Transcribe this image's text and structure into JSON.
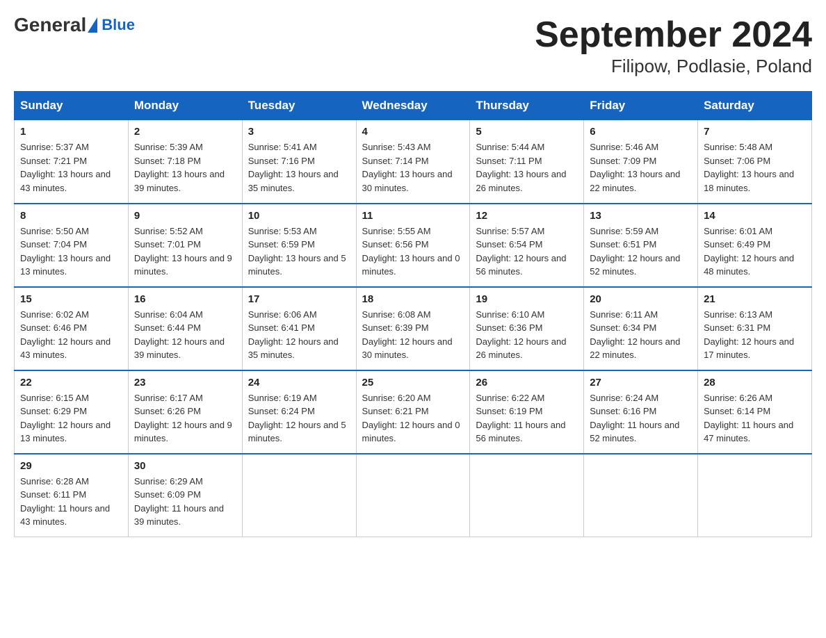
{
  "header": {
    "logo_general": "General",
    "logo_blue": "Blue",
    "month_year": "September 2024",
    "location": "Filipow, Podlasie, Poland"
  },
  "weekdays": [
    "Sunday",
    "Monday",
    "Tuesday",
    "Wednesday",
    "Thursday",
    "Friday",
    "Saturday"
  ],
  "weeks": [
    [
      {
        "day": "1",
        "sunrise": "5:37 AM",
        "sunset": "7:21 PM",
        "daylight": "13 hours and 43 minutes."
      },
      {
        "day": "2",
        "sunrise": "5:39 AM",
        "sunset": "7:18 PM",
        "daylight": "13 hours and 39 minutes."
      },
      {
        "day": "3",
        "sunrise": "5:41 AM",
        "sunset": "7:16 PM",
        "daylight": "13 hours and 35 minutes."
      },
      {
        "day": "4",
        "sunrise": "5:43 AM",
        "sunset": "7:14 PM",
        "daylight": "13 hours and 30 minutes."
      },
      {
        "day": "5",
        "sunrise": "5:44 AM",
        "sunset": "7:11 PM",
        "daylight": "13 hours and 26 minutes."
      },
      {
        "day": "6",
        "sunrise": "5:46 AM",
        "sunset": "7:09 PM",
        "daylight": "13 hours and 22 minutes."
      },
      {
        "day": "7",
        "sunrise": "5:48 AM",
        "sunset": "7:06 PM",
        "daylight": "13 hours and 18 minutes."
      }
    ],
    [
      {
        "day": "8",
        "sunrise": "5:50 AM",
        "sunset": "7:04 PM",
        "daylight": "13 hours and 13 minutes."
      },
      {
        "day": "9",
        "sunrise": "5:52 AM",
        "sunset": "7:01 PM",
        "daylight": "13 hours and 9 minutes."
      },
      {
        "day": "10",
        "sunrise": "5:53 AM",
        "sunset": "6:59 PM",
        "daylight": "13 hours and 5 minutes."
      },
      {
        "day": "11",
        "sunrise": "5:55 AM",
        "sunset": "6:56 PM",
        "daylight": "13 hours and 0 minutes."
      },
      {
        "day": "12",
        "sunrise": "5:57 AM",
        "sunset": "6:54 PM",
        "daylight": "12 hours and 56 minutes."
      },
      {
        "day": "13",
        "sunrise": "5:59 AM",
        "sunset": "6:51 PM",
        "daylight": "12 hours and 52 minutes."
      },
      {
        "day": "14",
        "sunrise": "6:01 AM",
        "sunset": "6:49 PM",
        "daylight": "12 hours and 48 minutes."
      }
    ],
    [
      {
        "day": "15",
        "sunrise": "6:02 AM",
        "sunset": "6:46 PM",
        "daylight": "12 hours and 43 minutes."
      },
      {
        "day": "16",
        "sunrise": "6:04 AM",
        "sunset": "6:44 PM",
        "daylight": "12 hours and 39 minutes."
      },
      {
        "day": "17",
        "sunrise": "6:06 AM",
        "sunset": "6:41 PM",
        "daylight": "12 hours and 35 minutes."
      },
      {
        "day": "18",
        "sunrise": "6:08 AM",
        "sunset": "6:39 PM",
        "daylight": "12 hours and 30 minutes."
      },
      {
        "day": "19",
        "sunrise": "6:10 AM",
        "sunset": "6:36 PM",
        "daylight": "12 hours and 26 minutes."
      },
      {
        "day": "20",
        "sunrise": "6:11 AM",
        "sunset": "6:34 PM",
        "daylight": "12 hours and 22 minutes."
      },
      {
        "day": "21",
        "sunrise": "6:13 AM",
        "sunset": "6:31 PM",
        "daylight": "12 hours and 17 minutes."
      }
    ],
    [
      {
        "day": "22",
        "sunrise": "6:15 AM",
        "sunset": "6:29 PM",
        "daylight": "12 hours and 13 minutes."
      },
      {
        "day": "23",
        "sunrise": "6:17 AM",
        "sunset": "6:26 PM",
        "daylight": "12 hours and 9 minutes."
      },
      {
        "day": "24",
        "sunrise": "6:19 AM",
        "sunset": "6:24 PM",
        "daylight": "12 hours and 5 minutes."
      },
      {
        "day": "25",
        "sunrise": "6:20 AM",
        "sunset": "6:21 PM",
        "daylight": "12 hours and 0 minutes."
      },
      {
        "day": "26",
        "sunrise": "6:22 AM",
        "sunset": "6:19 PM",
        "daylight": "11 hours and 56 minutes."
      },
      {
        "day": "27",
        "sunrise": "6:24 AM",
        "sunset": "6:16 PM",
        "daylight": "11 hours and 52 minutes."
      },
      {
        "day": "28",
        "sunrise": "6:26 AM",
        "sunset": "6:14 PM",
        "daylight": "11 hours and 47 minutes."
      }
    ],
    [
      {
        "day": "29",
        "sunrise": "6:28 AM",
        "sunset": "6:11 PM",
        "daylight": "11 hours and 43 minutes."
      },
      {
        "day": "30",
        "sunrise": "6:29 AM",
        "sunset": "6:09 PM",
        "daylight": "11 hours and 39 minutes."
      },
      null,
      null,
      null,
      null,
      null
    ]
  ]
}
